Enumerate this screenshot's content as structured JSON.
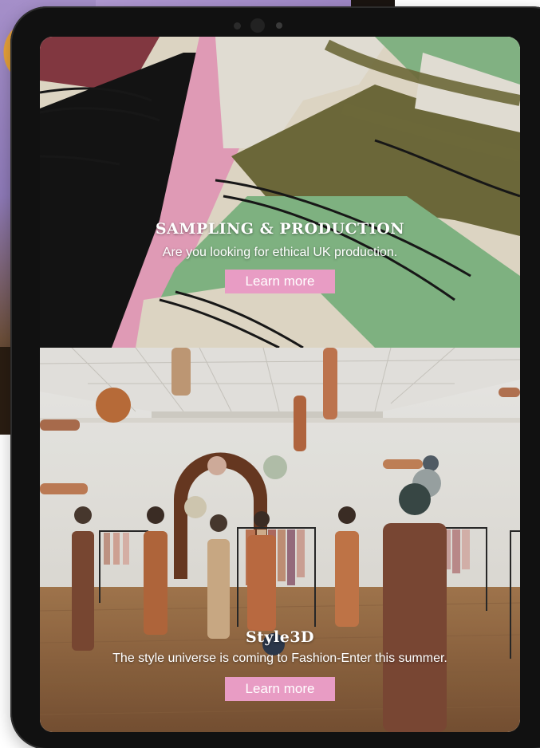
{
  "colors": {
    "button_bg": "#e89cc4",
    "button_text": "#ffffff",
    "device_frame": "#111111",
    "text_overlay": "#ffffff"
  },
  "panels": [
    {
      "image": "silk-fabric-photo",
      "title": "SAMPLING & PRODUCTION",
      "description": "Are you looking for ethical UK production.",
      "button_label": "Learn more"
    },
    {
      "image": "virtual-showroom-render",
      "title": "Style3D",
      "description": "The style universe is coming to Fashion-Enter this summer.",
      "button_label": "Learn more"
    }
  ]
}
